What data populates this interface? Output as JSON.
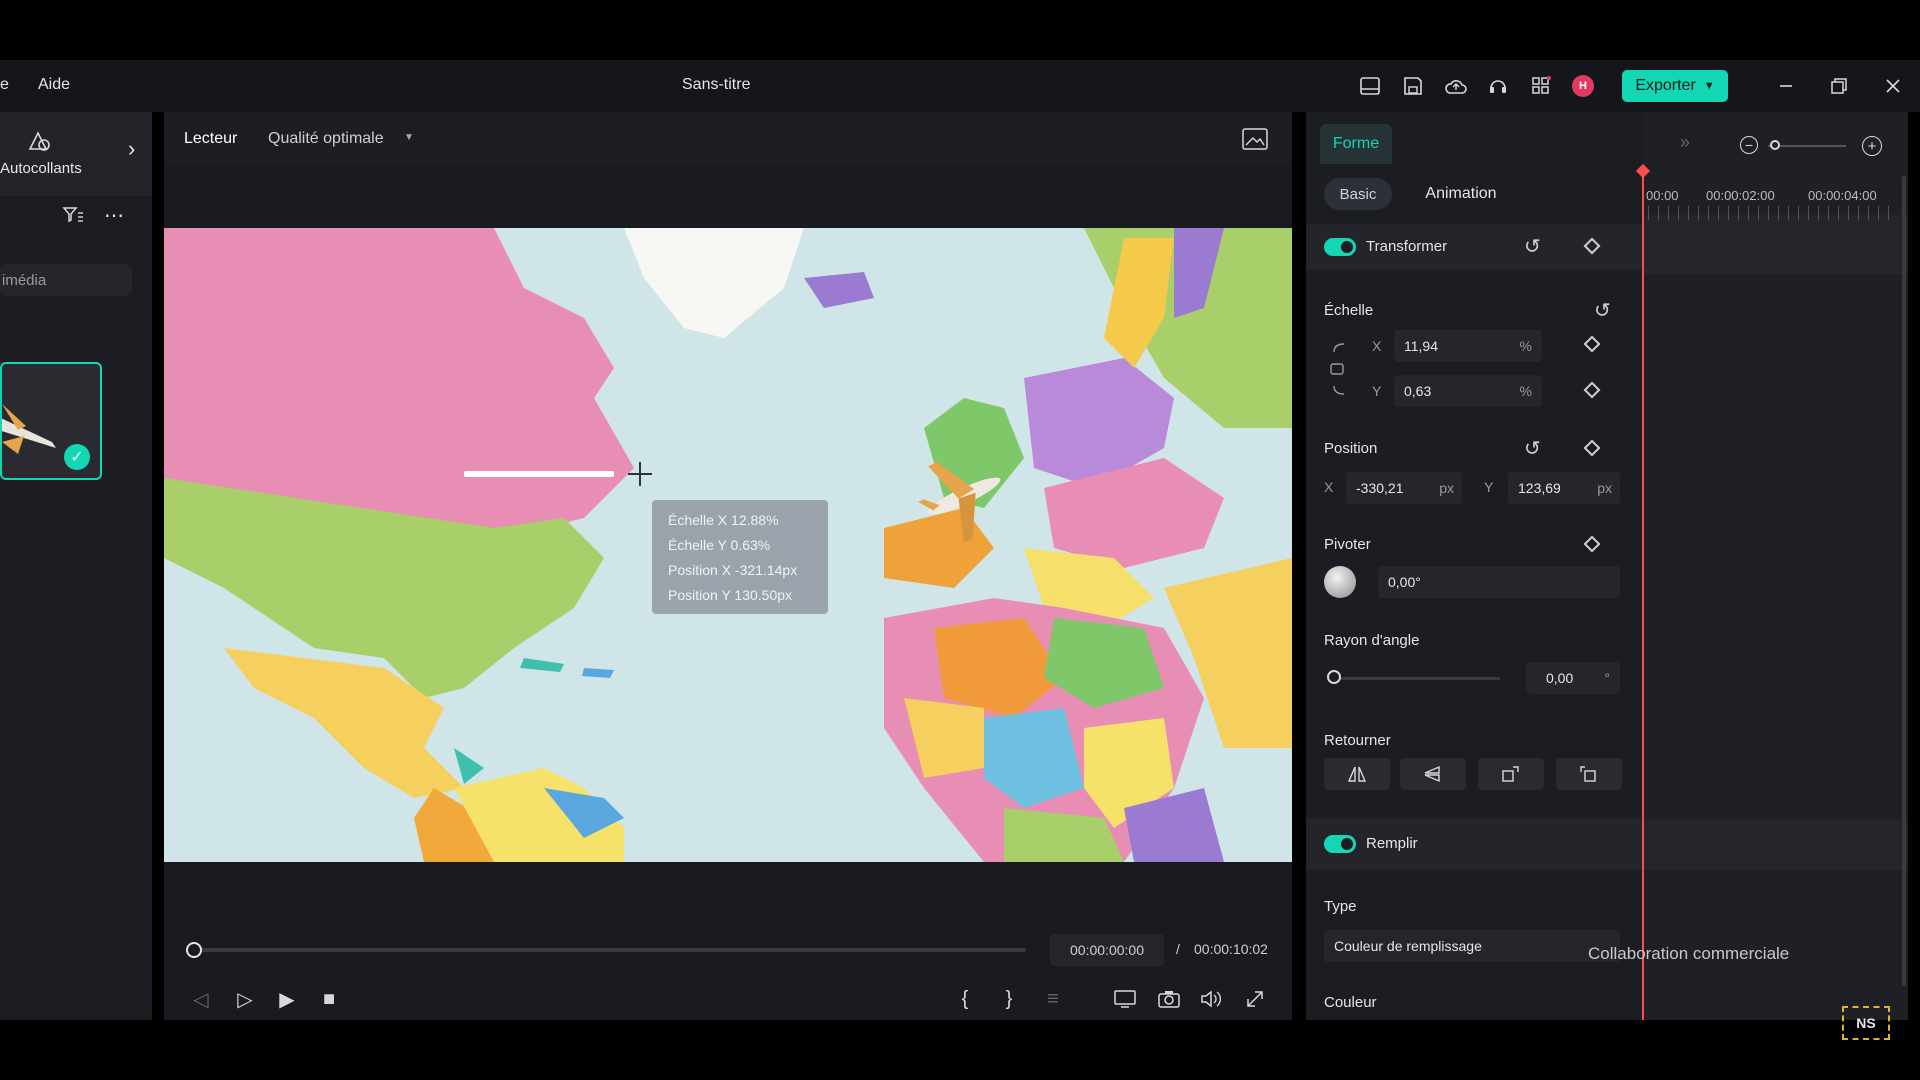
{
  "menu": {
    "partial_left": "e",
    "help": "Aide"
  },
  "window": {
    "title": "Sans-titre"
  },
  "toolbar": {
    "avatar_initial": "H",
    "export_label": "Exporter",
    "icons": [
      "layout-icon",
      "save-icon",
      "cloud-upload-icon",
      "headset-icon",
      "apps-grid-icon",
      "minimize-icon",
      "restore-icon",
      "close-icon"
    ]
  },
  "left_panel": {
    "stickers_label": "Autocollants",
    "search_placeholder": "imédia"
  },
  "player": {
    "tab_label": "Lecteur",
    "quality_label": "Qualité optimale",
    "tooltip": {
      "scale_x": "Échelle X  12.88%",
      "scale_y": "Échelle Y  0.63%",
      "pos_x": "Position X -321.14px",
      "pos_y": "Position Y 130.50px"
    },
    "current_time": "00:00:00:00",
    "separator": "/",
    "total_time": "00:00:10:02",
    "progress": 0.0
  },
  "properties": {
    "tab_label": "Forme",
    "seg_basic": "Basic",
    "seg_animation": "Animation",
    "transform_label": "Transformer",
    "scale_label": "Échelle",
    "scale_x_axis": "X",
    "scale_x_value": "11,94",
    "scale_y_axis": "Y",
    "scale_y_value": "0,63",
    "percent": "%",
    "position_label": "Position",
    "pos_x_axis": "X",
    "pos_x_value": "-330,21",
    "pos_y_axis": "Y",
    "pos_y_value": "123,69",
    "px": "px",
    "rotate_label": "Pivoter",
    "rotate_value": "0,00°",
    "corner_label": "Rayon d'angle",
    "corner_value": "0,00",
    "corner_unit": "°",
    "corner_level": 0.0,
    "flip_label": "Retourner",
    "fill_label": "Remplir",
    "type_label": "Type",
    "type_value": "Couleur de remplissage",
    "color_label": "Couleur"
  },
  "timeline": {
    "ticks": [
      "00:00",
      "00:00:02:00",
      "00:00:04:00"
    ]
  },
  "overlay": {
    "watermark": "Collaboration commerciale",
    "logo_text": "NS"
  }
}
